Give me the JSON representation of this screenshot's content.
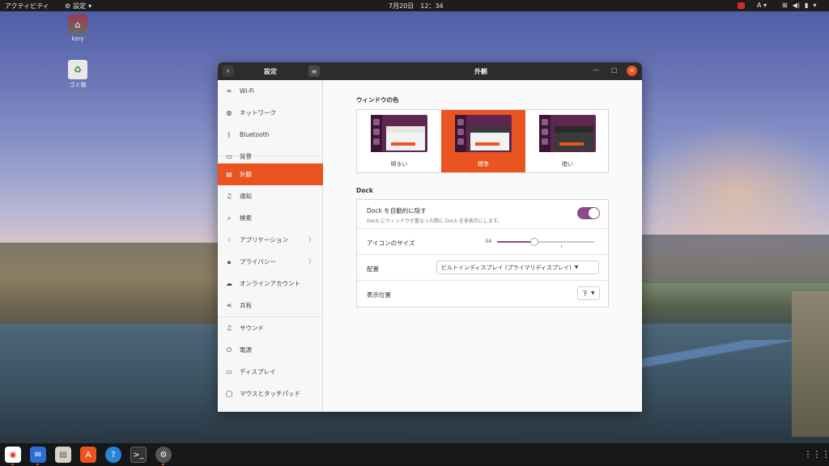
{
  "topbar": {
    "activities": "アクティビティ",
    "app_menu": "設定",
    "clock": "7月20日　12：34",
    "ime": "A"
  },
  "desktop": {
    "home_label": "kzry",
    "trash_label": "ゴミ箱"
  },
  "window": {
    "sidebar_title": "設定",
    "page_title": "外観",
    "close_color": "#e95420"
  },
  "sidebar": {
    "items": [
      {
        "label": "Wi-Fi",
        "icon": "wifi-icon"
      },
      {
        "label": "ネットワーク",
        "icon": "network-icon"
      },
      {
        "label": "Bluetooth",
        "icon": "bluetooth-icon"
      },
      {
        "label": "背景",
        "icon": "background-icon"
      },
      {
        "label": "外観",
        "icon": "appearance-icon",
        "active": true
      },
      {
        "label": "通知",
        "icon": "bell-icon"
      },
      {
        "label": "検索",
        "icon": "search-icon"
      },
      {
        "label": "アプリケーション",
        "icon": "apps-icon",
        "chevron": true
      },
      {
        "label": "プライバシー",
        "icon": "lock-icon",
        "chevron": true
      },
      {
        "label": "オンラインアカウント",
        "icon": "cloud-icon"
      },
      {
        "label": "共有",
        "icon": "share-icon"
      },
      {
        "label": "サウンド",
        "icon": "music-icon"
      },
      {
        "label": "電源",
        "icon": "power-icon"
      },
      {
        "label": "ディスプレイ",
        "icon": "display-icon"
      },
      {
        "label": "マウスとタッチパッド",
        "icon": "mouse-icon"
      }
    ]
  },
  "appearance": {
    "window_color_label": "ウィンドウの色",
    "variants": [
      {
        "label": "明るい",
        "selected": false
      },
      {
        "label": "標準",
        "selected": true
      },
      {
        "label": "暗い",
        "selected": false
      }
    ],
    "dock_label": "Dock",
    "autohide_title": "Dock を自動的に隠す",
    "autohide_sub": "Dock にウィンドウが重なった際に Dock を非表示にします。",
    "autohide_on": true,
    "icon_size_label": "アイコンのサイズ",
    "icon_size_value": "34",
    "icon_size_fraction": 0.38,
    "position_label": "配置",
    "position_value": "ビルトインディスプレイ (プライマリディスプレイ)",
    "show_on_label": "表示位置",
    "show_on_value": "下",
    "accent": "#e95420",
    "toggle_color": "#8b4a85"
  },
  "dock": {
    "apps": [
      {
        "name": "chrome",
        "icon": "chrome-icon"
      },
      {
        "name": "thunderbird",
        "icon": "mail-icon"
      },
      {
        "name": "files",
        "icon": "files-icon"
      },
      {
        "name": "software",
        "icon": "software-icon"
      },
      {
        "name": "help",
        "icon": "help-icon"
      },
      {
        "name": "terminal",
        "icon": "terminal-icon"
      },
      {
        "name": "settings",
        "icon": "settings-gear-icon"
      }
    ]
  }
}
